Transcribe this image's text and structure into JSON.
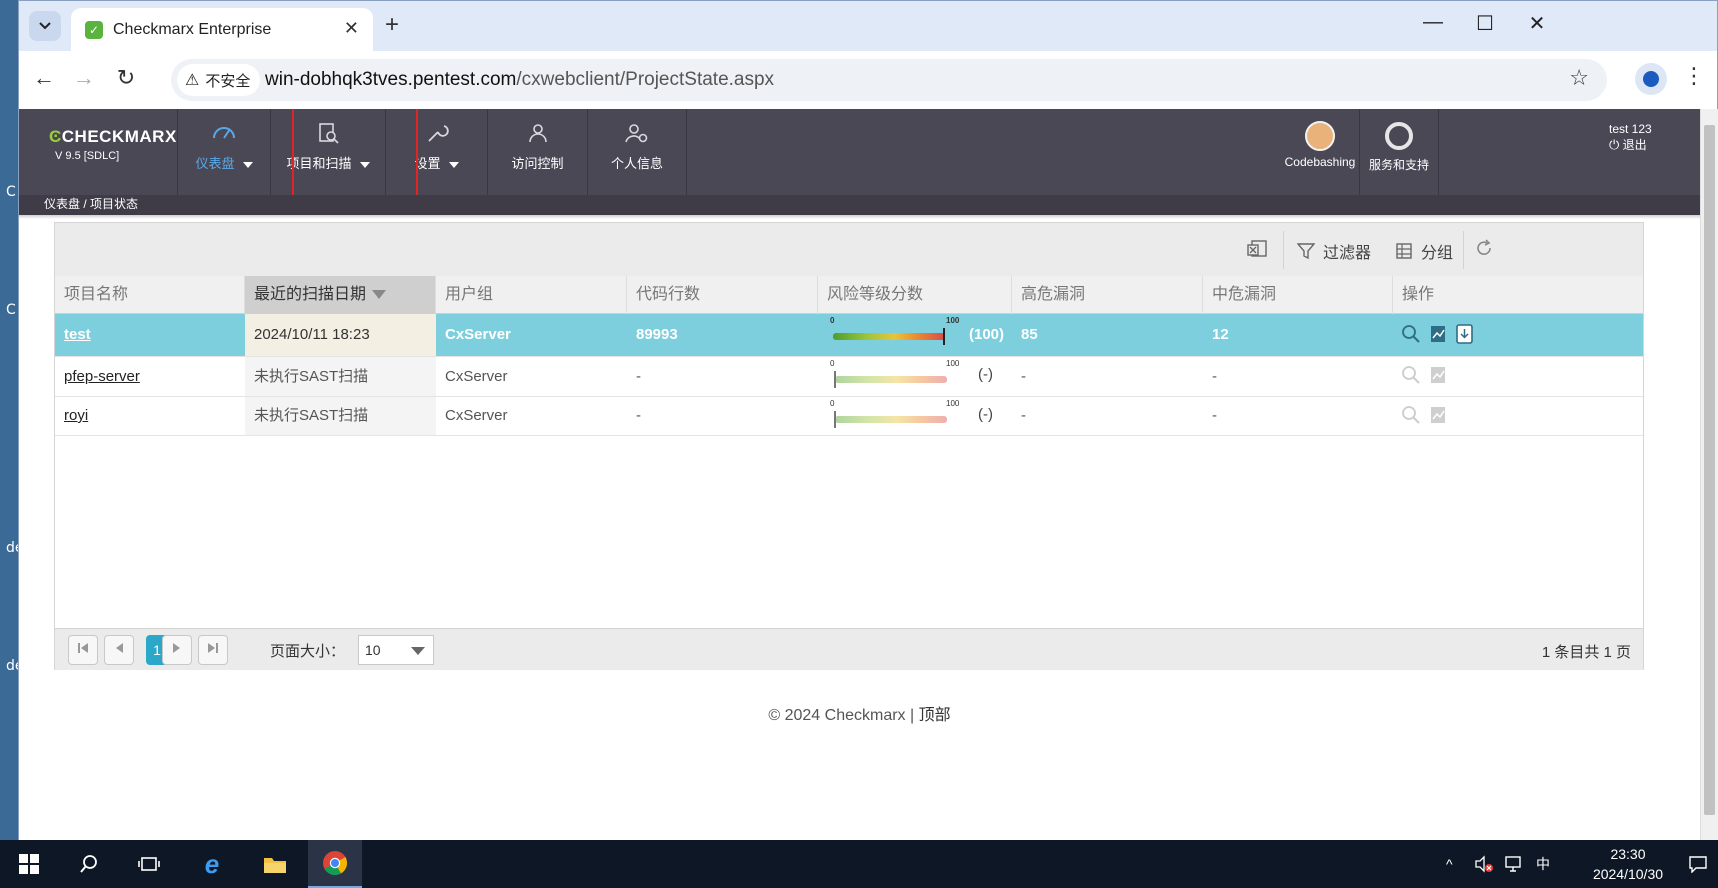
{
  "browser": {
    "tab_title": "Checkmarx Enterprise",
    "security_label": "不安全",
    "url_domain": "win-dobhqk3tves.pentest.com",
    "url_path": "/cxwebclient/ProjectState.aspx"
  },
  "desktop": {
    "labels": [
      "C",
      "C",
      "de",
      "de"
    ]
  },
  "app": {
    "brand": "CHECKMARX",
    "version": "V 9.5  [SDLC]",
    "menu": [
      {
        "label": "仪表盘",
        "icon": "dashboard-gauge-icon",
        "active": true,
        "dropdown": true
      },
      {
        "label": "项目和扫描",
        "icon": "project-scan-icon",
        "active": false,
        "dropdown": true
      },
      {
        "label": "设置",
        "icon": "wrench-icon",
        "active": false,
        "dropdown": true
      },
      {
        "label": "访问控制",
        "icon": "access-control-icon",
        "active": false,
        "dropdown": false
      },
      {
        "label": "个人信息",
        "icon": "user-gear-icon",
        "active": false,
        "dropdown": false
      }
    ],
    "codebashing_label": "Codebashing",
    "support_label": "服务和支持",
    "user_name": "test 123",
    "logout_label": "退出",
    "breadcrumb": "仪表盘 / 项目状态"
  },
  "grid": {
    "toolbar": {
      "filter_label": "过滤器",
      "group_label": "分组"
    },
    "columns": [
      "项目名称",
      "最近的扫描日期",
      "用户组",
      "代码行数",
      "风险等级分数",
      "高危漏洞",
      "中危漏洞",
      "操作"
    ],
    "risk_scale_min": "0",
    "risk_scale_max": "100",
    "rows": [
      {
        "name": "test",
        "date": "2024/10/11 18:23",
        "group": "CxServer",
        "loc": "89993",
        "risk_score": "(100)",
        "risk_value": 100,
        "high": "85",
        "medium": "12",
        "selected": true
      },
      {
        "name": "pfep-server",
        "date": "未执行SAST扫描",
        "group": "CxServer",
        "loc": "-",
        "risk_score": "(-)",
        "risk_value": 0,
        "high": "-",
        "medium": "-",
        "selected": false
      },
      {
        "name": "royi",
        "date": "未执行SAST扫描",
        "group": "CxServer",
        "loc": "-",
        "risk_score": "(-)",
        "risk_value": 0,
        "high": "-",
        "medium": "-",
        "selected": false
      }
    ],
    "pager": {
      "current_page": "1",
      "page_size_label": "页面大小：",
      "page_size": "10",
      "summary": "1 条目共 1 页"
    }
  },
  "footer": {
    "copyright": "© 2024 Checkmarx | ",
    "top_link": "顶部"
  },
  "taskbar": {
    "ime": "中",
    "time": "23:30",
    "date": "2024/10/30"
  },
  "colors": {
    "header_bg": "#4b4856",
    "accent_blue": "#5aa9e6",
    "selected_row": "#7ecfdd",
    "highlight_red": "#e32424",
    "brand_green": "#9bd03a"
  }
}
